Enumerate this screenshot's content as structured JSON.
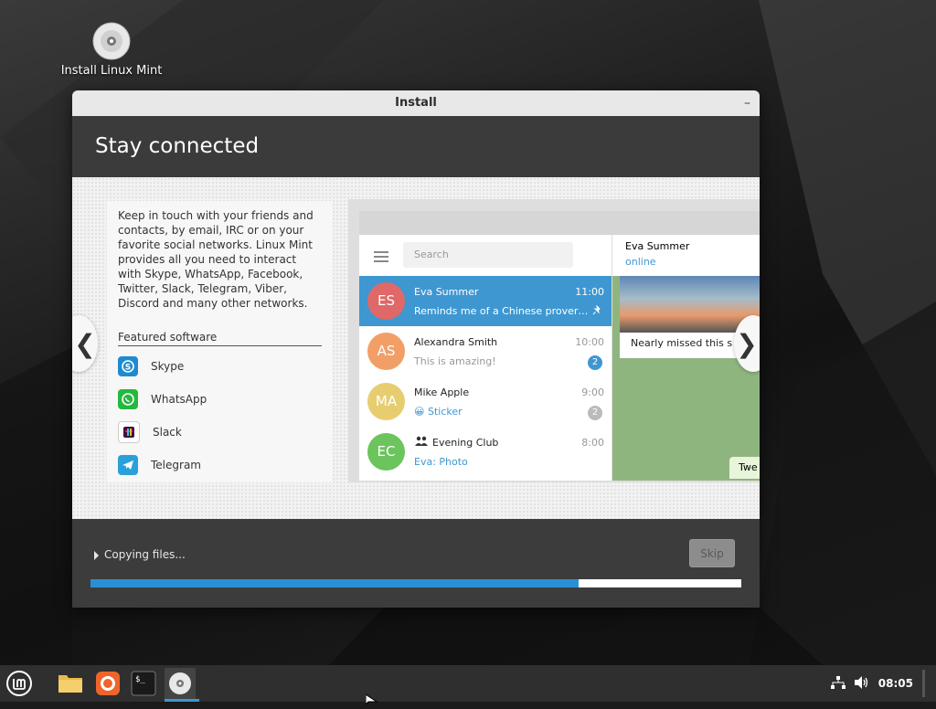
{
  "desktop": {
    "icon_label": "Install Linux Mint"
  },
  "window": {
    "title": "Install",
    "minimize_glyph": "–",
    "header": "Stay connected"
  },
  "slide": {
    "description": "Keep in touch with your friends and contacts, by email, IRC or on your favorite social networks. Linux Mint provides all you need to interact with Skype, WhatsApp, Facebook, Twitter, Slack, Telegram, Viber, Discord and many other networks.",
    "featured_title": "Featured software",
    "featured": [
      {
        "name": "Skype",
        "icon": "skype-icon",
        "color": "#1e8bd1"
      },
      {
        "name": "WhatsApp",
        "icon": "whatsapp-icon",
        "color": "#25b83f"
      },
      {
        "name": "Slack",
        "icon": "slack-icon",
        "color": "#3f0f3f"
      },
      {
        "name": "Telegram",
        "icon": "telegram-icon",
        "color": "#2aa0da"
      }
    ],
    "prev_glyph": "❮",
    "next_glyph": "❯"
  },
  "telegram": {
    "search_placeholder": "Search",
    "chats": [
      {
        "initials": "ES",
        "name": "Eva Summer",
        "message": "Reminds me of a Chinese prover…",
        "time": "11:00",
        "color": "#e06868",
        "badge": "",
        "active": true
      },
      {
        "initials": "AS",
        "name": "Alexandra Smith",
        "message": "This is amazing!",
        "time": "10:00",
        "color": "#f29f67",
        "badge": "2",
        "active": false
      },
      {
        "initials": "MA",
        "name": "Mike Apple",
        "message": "😀 Sticker",
        "time": "9:00",
        "color": "#e8cd70",
        "badge": "2",
        "active": false
      },
      {
        "initials": "EC",
        "name": "Evening Club",
        "message": "Eva: Photo",
        "time": "8:00",
        "color": "#6bc45c",
        "badge": "",
        "active": false
      }
    ],
    "contact_name": "Eva Summer",
    "contact_status": "online",
    "photo_caption": "Nearly missed this s",
    "bubble_text": "Twe"
  },
  "progress": {
    "status": "Copying files...",
    "skip_label": "Skip",
    "fraction": 0.75
  },
  "taskbar": {
    "clock": "08:05"
  },
  "colors": {
    "accent": "#3e97d1",
    "progress": "#2b8fd6"
  }
}
